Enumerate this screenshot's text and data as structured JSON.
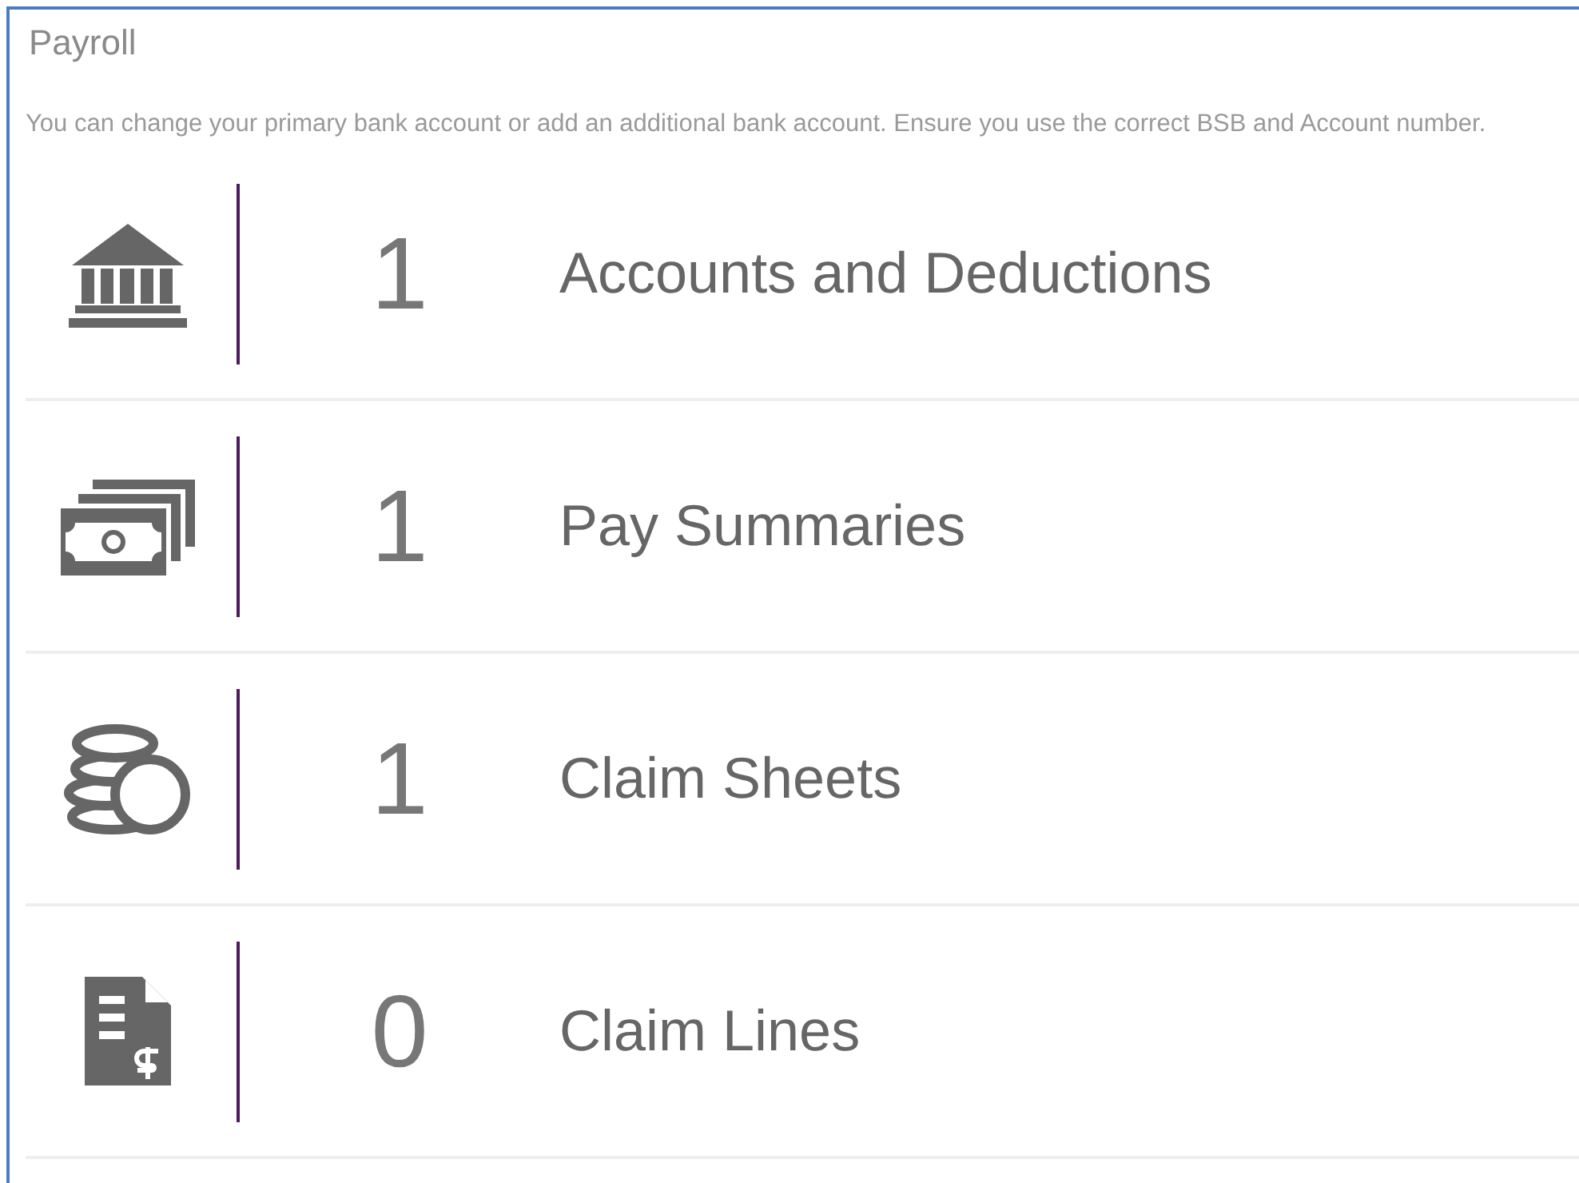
{
  "panel": {
    "title": "Payroll",
    "description": "You can change your primary bank account or add an additional bank account. Ensure you use the correct BSB and Account number."
  },
  "items": [
    {
      "kind": "bank",
      "count": "1",
      "label": "Accounts and Deductions"
    },
    {
      "kind": "money",
      "count": "1",
      "label": "Pay Summaries"
    },
    {
      "kind": "coins",
      "count": "1",
      "label": "Claim Sheets"
    },
    {
      "kind": "invoice",
      "count": "0",
      "label": "Claim Lines"
    }
  ]
}
